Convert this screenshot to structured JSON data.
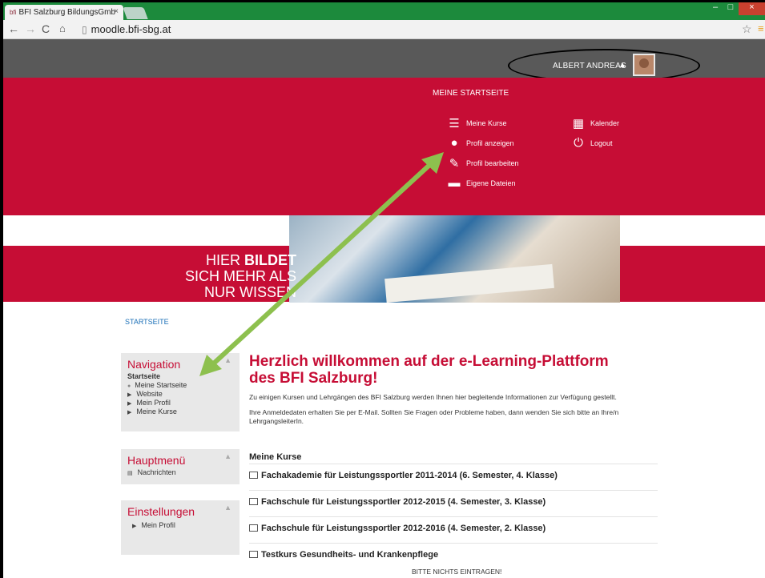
{
  "browser": {
    "tab_title": "BFI Salzburg BildungsGmb",
    "url": "moodle.bfi-sbg.at"
  },
  "user": {
    "name": "ALBERT ANDREAS"
  },
  "user_menu": {
    "heading": "MEINE STARTSEITE",
    "items": [
      {
        "label": "Meine Kurse",
        "icon": "list-icon"
      },
      {
        "label": "Kalender",
        "icon": "calendar-icon"
      },
      {
        "label": "Profil anzeigen",
        "icon": "user-icon"
      },
      {
        "label": "Logout",
        "icon": "power-icon"
      },
      {
        "label": "Profil bearbeiten",
        "icon": "pencil-icon"
      },
      {
        "label": "Eigene Dateien",
        "icon": "folder-icon"
      }
    ]
  },
  "banner": {
    "line1_a": "HIER ",
    "line1_b": "BILDET",
    "line2": "SICH MEHR ALS",
    "line3": "NUR WISSEN"
  },
  "breadcrumb": "STARTSEITE",
  "navigation": {
    "title": "Navigation",
    "home": "Startseite",
    "items": [
      "Meine Startseite",
      "Website",
      "Mein Profil",
      "Meine Kurse"
    ]
  },
  "hauptmenu": {
    "title": "Hauptmenü",
    "items": [
      "Nachrichten"
    ]
  },
  "einstellungen": {
    "title": "Einstellungen",
    "items": [
      "Mein Profil"
    ]
  },
  "main": {
    "title_line1": "Herzlich willkommen auf der e-Learning-Plattform",
    "title_line2": "des BFI Salzburg!",
    "para1": "Zu einigen Kursen und Lehrgängen des BFI Salzburg werden Ihnen hier begleitende Informationen zur Verfügung gestellt.",
    "para2": "Ihre Anmeldedaten erhalten Sie per E-Mail. Sollten Sie Fragen oder Probleme haben, dann wenden Sie sich bitte an Ihre/n LehrgangsleiterIn.",
    "courses_heading": "Meine Kurse",
    "courses": [
      "Fachakademie für Leistungssportler 2011-2014 (6. Semester, 4. Klasse)",
      "Fachschule für Leistungssportler 2012-2015 (4. Semester, 3. Klasse)",
      "Fachschule für Leistungssportler 2012-2016 (4. Semester, 2. Klasse)",
      "Testkurs Gesundheits- und Krankenpflege"
    ],
    "note": "BITTE NICHTS EINTRAGEN!"
  },
  "colors": {
    "brand_red": "#c60d35",
    "annotation_arrow": "#8dc04e"
  }
}
